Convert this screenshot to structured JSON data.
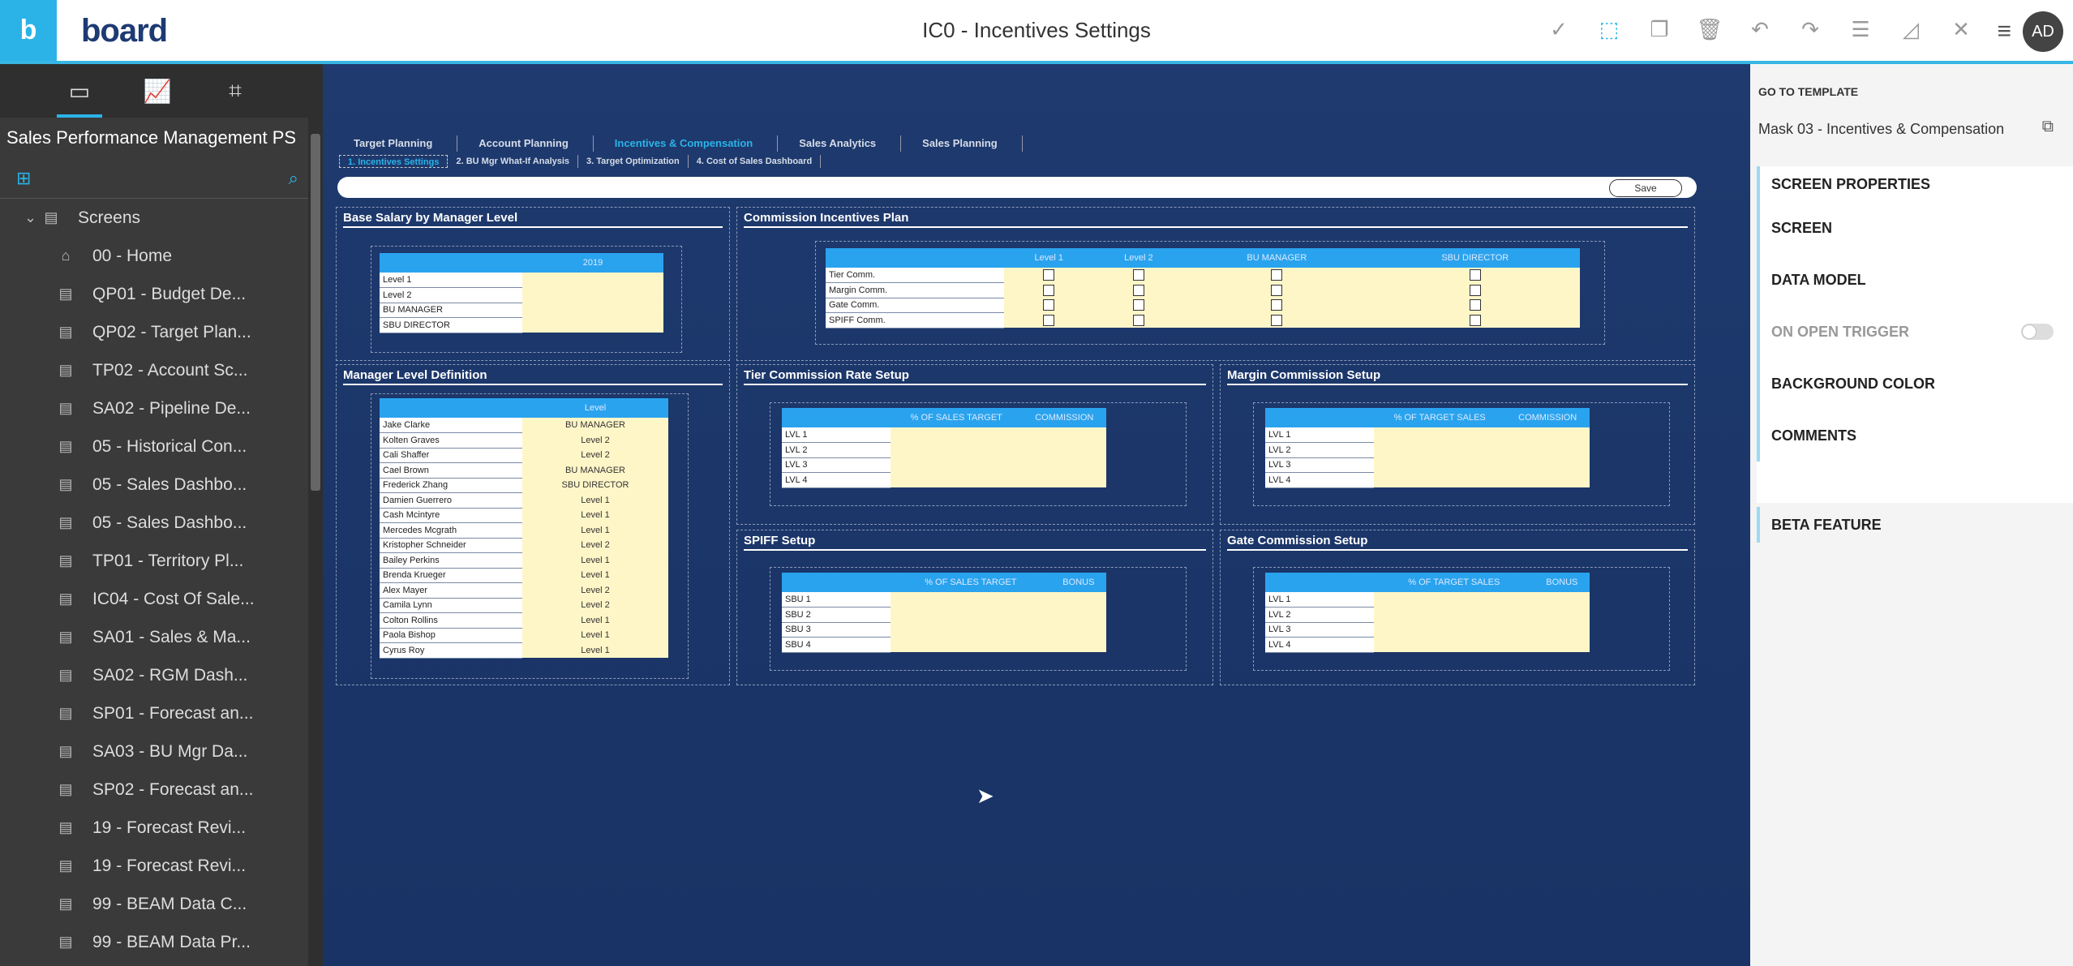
{
  "app": {
    "logo": "b",
    "brand": "board",
    "title": "IC0 - Incentives Settings",
    "avatar": "AD"
  },
  "sidebar": {
    "project": "Sales Performance Management PS",
    "root": "Screens",
    "items": [
      {
        "label": "00 - Home",
        "icon": "home-icon"
      },
      {
        "label": "QP01 - Budget De...",
        "icon": "screen-icon"
      },
      {
        "label": "QP02 - Target Plan...",
        "icon": "screen-icon"
      },
      {
        "label": "TP02 - Account Sc...",
        "icon": "screen-icon"
      },
      {
        "label": "SA02 - Pipeline De...",
        "icon": "screen-icon"
      },
      {
        "label": "05 - Historical Con...",
        "icon": "screen-icon"
      },
      {
        "label": "05 - Sales Dashbo...",
        "icon": "screen-icon"
      },
      {
        "label": "05 - Sales Dashbo...",
        "icon": "screen-icon"
      },
      {
        "label": "TP01 - Territory Pl...",
        "icon": "screen-icon"
      },
      {
        "label": "IC04 - Cost Of Sale...",
        "icon": "screen-icon"
      },
      {
        "label": "SA01 - Sales & Ma...",
        "icon": "screen-icon"
      },
      {
        "label": "SA02 - RGM Dash...",
        "icon": "screen-icon"
      },
      {
        "label": "SP01 - Forecast an...",
        "icon": "screen-icon"
      },
      {
        "label": "SA03 - BU Mgr Da...",
        "icon": "screen-icon"
      },
      {
        "label": "SP02 - Forecast an...",
        "icon": "screen-icon"
      },
      {
        "label": "19 - Forecast Revi...",
        "icon": "screen-icon"
      },
      {
        "label": "19 - Forecast Revi...",
        "icon": "screen-icon"
      },
      {
        "label": "99 - BEAM Data C...",
        "icon": "screen-icon"
      },
      {
        "label": "99 - BEAM Data Pr...",
        "icon": "screen-icon"
      }
    ]
  },
  "nav": {
    "main": [
      "Target Planning",
      "Account Planning",
      "Incentives & Compensation",
      "Sales Analytics",
      "Sales Planning"
    ],
    "sub": [
      "1. Incentives Settings",
      "2. BU Mgr What-If Analysis",
      "3. Target Optimization",
      "4. Cost of Sales Dashboard"
    ],
    "save": "Save"
  },
  "base_salary": {
    "title": "Base Salary by Manager Level",
    "col": "2019",
    "rows": [
      "Level 1",
      "Level 2",
      "BU MANAGER",
      "SBU DIRECTOR"
    ]
  },
  "commission_plan": {
    "title": "Commission Incentives Plan",
    "cols": [
      "Level 1",
      "Level 2",
      "BU MANAGER",
      "SBU DIRECTOR"
    ],
    "rows": [
      "Tier Comm.",
      "Margin Comm.",
      "Gate Comm.",
      "SPIFF Comm."
    ]
  },
  "manager_level": {
    "title": "Manager Level Definition",
    "col": "Level",
    "rows": [
      [
        "Jake Clarke",
        "BU MANAGER"
      ],
      [
        "Kolten Graves",
        "Level 2"
      ],
      [
        "Cali Shaffer",
        "Level 2"
      ],
      [
        "Cael Brown",
        "BU MANAGER"
      ],
      [
        "Frederick Zhang",
        "SBU DIRECTOR"
      ],
      [
        "Damien Guerrero",
        "Level 1"
      ],
      [
        "Cash Mcintyre",
        "Level 1"
      ],
      [
        "Mercedes Mcgrath",
        "Level 1"
      ],
      [
        "Kristopher Schneider",
        "Level 2"
      ],
      [
        "Bailey Perkins",
        "Level 1"
      ],
      [
        "Brenda Krueger",
        "Level 1"
      ],
      [
        "Alex Mayer",
        "Level 2"
      ],
      [
        "Camila Lynn",
        "Level 2"
      ],
      [
        "Colton Rollins",
        "Level 1"
      ],
      [
        "Paola Bishop",
        "Level 1"
      ],
      [
        "Cyrus Roy",
        "Level 1"
      ]
    ]
  },
  "tier": {
    "title": "Tier Commission Rate Setup",
    "cols": [
      "% OF SALES TARGET",
      "COMMISSION"
    ],
    "rows": [
      "LVL 1",
      "LVL 2",
      "LVL 3",
      "LVL 4"
    ]
  },
  "margin": {
    "title": "Margin Commission Setup",
    "cols": [
      "% OF TARGET SALES",
      "COMMISSION"
    ],
    "rows": [
      "LVL 1",
      "LVL 2",
      "LVL 3",
      "LVL 4"
    ]
  },
  "spiff": {
    "title": "SPIFF Setup",
    "cols": [
      "% OF SALES TARGET",
      "BONUS"
    ],
    "rows": [
      "SBU 1",
      "SBU 2",
      "SBU 3",
      "SBU 4"
    ]
  },
  "gate": {
    "title": "Gate Commission Setup",
    "cols": [
      "% OF TARGET SALES",
      "BONUS"
    ],
    "rows": [
      "LVL 1",
      "LVL 2",
      "LVL 3",
      "LVL 4"
    ]
  },
  "rpanel": {
    "goto": "GO TO TEMPLATE",
    "mask": "Mask 03 - Incentives & Compensation",
    "props_head": "SCREEN PROPERTIES",
    "items": [
      "SCREEN",
      "DATA MODEL",
      "ON OPEN TRIGGER",
      "BACKGROUND COLOR",
      "COMMENTS"
    ],
    "beta": "BETA FEATURE"
  }
}
